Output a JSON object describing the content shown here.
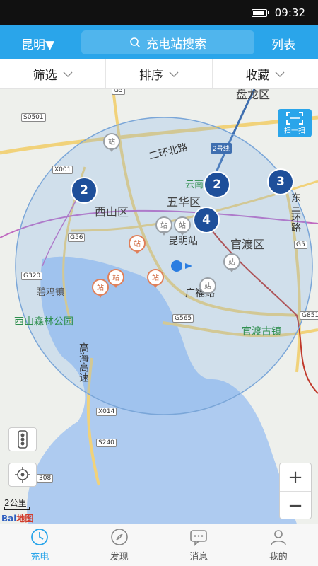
{
  "status_bar": {
    "time": "09:32"
  },
  "header": {
    "city": "昆明▼",
    "search_placeholder": "充电站搜索",
    "list_label": "列表"
  },
  "filters": [
    {
      "label": "筛选"
    },
    {
      "label": "排序"
    },
    {
      "label": "收藏"
    }
  ],
  "map": {
    "districts": [
      "五华区",
      "西山区",
      "官渡区",
      "盘龙区"
    ],
    "places": [
      "昆明站",
      "碧鸡镇",
      "西山森林公园",
      "官渡古镇",
      "云南"
    ],
    "roads": [
      "二环北路",
      "东三环路",
      "广福路",
      "高海高速",
      "2号线"
    ],
    "road_tags": [
      "G5",
      "S0501",
      "X001",
      "G56",
      "G320",
      "G565",
      "X014",
      "S240",
      "G851",
      "G5",
      "308"
    ],
    "clusters": [
      {
        "count": "2"
      },
      {
        "count": "2"
      },
      {
        "count": "3"
      },
      {
        "count": "4"
      }
    ],
    "station_label": "站",
    "scan_label": "扫一扫",
    "scale": "2公里",
    "baidu_logo_a": "Bai",
    "baidu_logo_b": "地图",
    "zoom_in": "+",
    "zoom_out": "−"
  },
  "tabs": [
    {
      "label": "充电",
      "icon": "clock-icon",
      "active": true
    },
    {
      "label": "发现",
      "icon": "compass-icon",
      "active": false
    },
    {
      "label": "消息",
      "icon": "message-icon",
      "active": false
    },
    {
      "label": "我的",
      "icon": "person-icon",
      "active": false
    }
  ],
  "colors": {
    "accent": "#2aa5ea",
    "cluster": "#1e4f9a",
    "station_gray": "#9aa0a6",
    "station_orange": "#e0805a"
  }
}
